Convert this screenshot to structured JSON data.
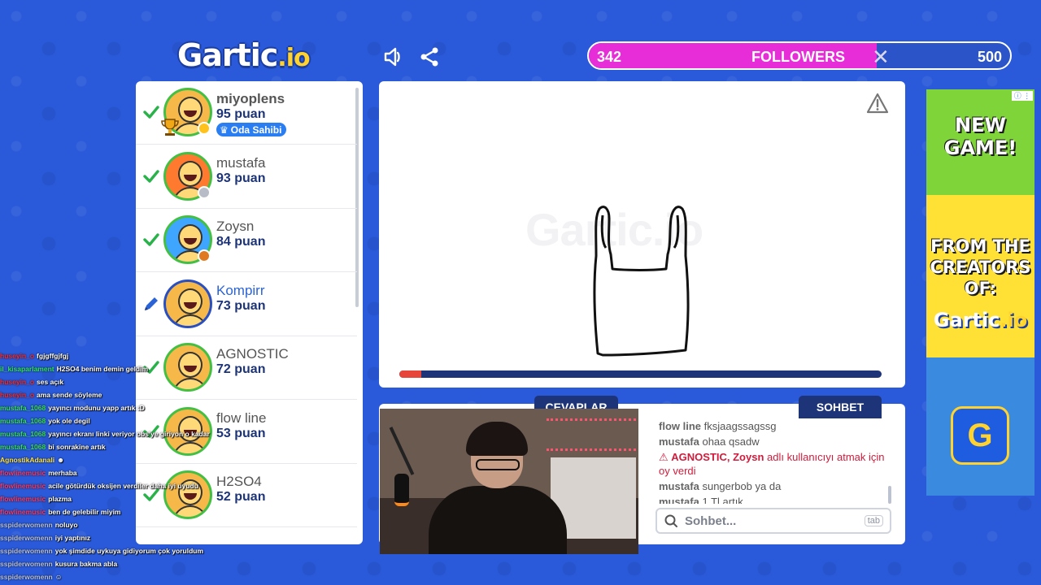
{
  "header": {
    "logo": "Gartic",
    "logo_suffix": ".io",
    "sound_icon": "speaker-icon",
    "share_icon": "share-icon"
  },
  "followers": {
    "current": "342",
    "label": "FOLLOWERS",
    "goal": "500",
    "progress": 0.684,
    "fill_color": "#e62dd8"
  },
  "players": [
    {
      "name": "miyoplens",
      "score": "95 puan",
      "owner": true,
      "badge": "Oda Sahibi",
      "status_color": "#ffc21c",
      "avatar_color": "#f7b84a"
    },
    {
      "name": "mustafa",
      "score": "93 puan",
      "status_color": "#b8bcc6",
      "avatar_color": "#ff7a2e"
    },
    {
      "name": "Zoysn",
      "score": "84 puan",
      "status_color": "#e07a20",
      "avatar_color": "#3fa6ff"
    },
    {
      "name": "Kompirr",
      "score": "73 puan",
      "drawer": true,
      "avatar_color": "#f7b84a"
    },
    {
      "name": "AGNOSTIC",
      "score": "72 puan",
      "avatar_color": "#f7b84a"
    },
    {
      "name": "flow line",
      "score": "53 puan",
      "avatar_color": "#f7b84a"
    },
    {
      "name": "H2SO4",
      "score": "52 puan",
      "avatar_color": "#f7b84a"
    }
  ],
  "canvas": {
    "watermark": "Gartic.io",
    "report_icon": "warning-icon",
    "timer_progress": 0.045,
    "timer_color": "#e8453a"
  },
  "tabs": {
    "answers": "CEVAPLAR",
    "chat": "SOHBET"
  },
  "chat": {
    "messages": [
      {
        "user": "flow line",
        "text": "fksjaagssagssg"
      },
      {
        "user": "mustafa",
        "text": "ohaa qsadw"
      },
      {
        "system": true,
        "user": "AGNOSTIC",
        "target": "Zoysn",
        "text": "adlı kullanıcıyı atmak için oy verdi"
      },
      {
        "user": "mustafa",
        "text": "sungerbob ya da"
      },
      {
        "user": "mustafa",
        "text": "1 Tl artık"
      }
    ],
    "input_placeholder": "Sohbet...",
    "input_hint": "tab"
  },
  "ad": {
    "line1": "NEW GAME!",
    "line2": "FROM THE CREATORS OF:",
    "brand": "Gartic",
    "brand_suffix": ".io",
    "button_letter": "G"
  },
  "stream_chat": [
    {
      "user": "huseyin_o",
      "text": "fgjgffgjfgj",
      "color": "#ff2a2a"
    },
    {
      "user": "il_kisaparlament",
      "text": "H2SO4 benim demin geldim",
      "color": "#2ee85a"
    },
    {
      "user": "huseyin_o",
      "text": "ses açık",
      "color": "#ff2a2a"
    },
    {
      "user": "huseyin_o",
      "text": "ama sende söyleme",
      "color": "#ff2a2a"
    },
    {
      "user": "mustafa_1068",
      "text": "yayıncı modunu yapp artık :D",
      "color": "#36e05a"
    },
    {
      "user": "mustafa_1068",
      "text": "yok ole degil",
      "color": "#36e05a"
    },
    {
      "user": "mustafa_1068",
      "text": "yayıncı ekranı linki veriyor obs'ye giriyon o kadar",
      "color": "#36e05a"
    },
    {
      "user": "mustafa_1068",
      "text": "bi sonrakine artık",
      "color": "#36e05a"
    },
    {
      "user": "AgnostikAdanali",
      "text": "☻",
      "color": "#ffe23a"
    },
    {
      "user": "flowlinemusic",
      "text": "merhaba",
      "color": "#ff3a6a"
    },
    {
      "user": "flowlinemusic",
      "text": "acile götürdük oksijen verdiler daha iyi uyudu",
      "color": "#ff3a6a"
    },
    {
      "user": "flowlinemusic",
      "text": "plazma",
      "color": "#ff3a6a"
    },
    {
      "user": "flowlinemusic",
      "text": "ben de gelebilir miyim",
      "color": "#ff3a6a"
    },
    {
      "user": "sspiderwomenn",
      "text": "noluyo",
      "color": "#b8c0d8"
    },
    {
      "user": "sspiderwomenn",
      "text": "iyi yaptınız",
      "color": "#b8c0d8"
    },
    {
      "user": "sspiderwomenn",
      "text": "yok şimdide uykuya gidiyorum çok yoruldum",
      "color": "#b8c0d8"
    },
    {
      "user": "sspiderwomenn",
      "text": "kusura bakma abla",
      "color": "#b8c0d8"
    },
    {
      "user": "sspiderwomenn",
      "text": "☺",
      "color": "#b8c0d8"
    }
  ]
}
